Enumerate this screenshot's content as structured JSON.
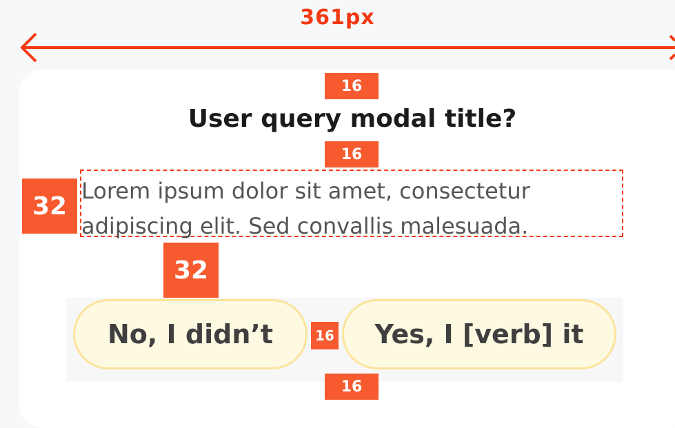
{
  "spec": {
    "width_label": "361px",
    "accent_color": "#f33a12",
    "badge_color": "#f75a2f",
    "spacing_badges": {
      "top_padding": "16",
      "title_gap": "16",
      "side_padding": "32",
      "body_to_buttons": "32",
      "button_gap": "16",
      "bottom_padding": "16"
    }
  },
  "modal": {
    "title": "User query modal title?",
    "body": "Lorem ipsum dolor sit amet, consectetur adipiscing elit. Sed convallis malesuada.",
    "buttons": {
      "no_label": "No, I didn’t",
      "yes_label": "Yes, I [verb] it"
    }
  }
}
